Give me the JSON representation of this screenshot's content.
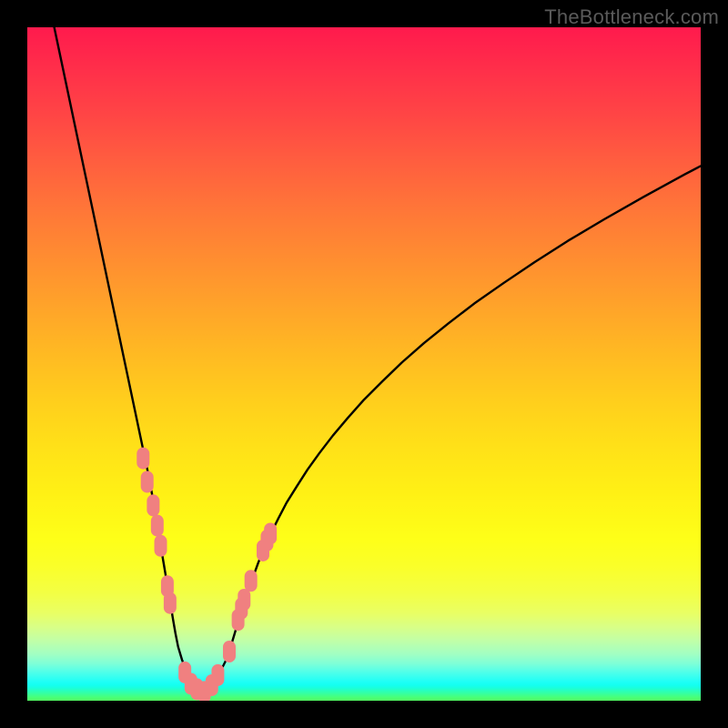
{
  "watermark": "TheBottleneck.com",
  "chart_data": {
    "type": "line",
    "title": "",
    "xlabel": "",
    "ylabel": "",
    "xlim": [
      0,
      100
    ],
    "ylim": [
      0,
      100
    ],
    "curve_left": {
      "x": [
        4,
        6,
        8,
        10,
        12,
        13,
        14,
        15,
        16,
        17,
        18,
        18.6,
        19.1,
        19.6,
        20.0,
        20.3,
        20.6,
        21.0,
        21.3,
        21.6,
        22.0,
        22.4,
        23.0,
        23.8,
        24.8,
        26.0
      ],
      "y": [
        100,
        90.5,
        81,
        71.5,
        62,
        57.25,
        52.5,
        47.75,
        43,
        38.25,
        33.5,
        30.25,
        27.3,
        24.3,
        21.85,
        20.1,
        18.3,
        16.0,
        14.2,
        12.3,
        10.0,
        8.0,
        6.0,
        4.0,
        2.2,
        1.3
      ]
    },
    "curve_right": {
      "x": [
        26,
        27.2,
        28.5,
        29.5,
        30.2,
        30.8,
        31.4,
        32.0,
        32.7,
        33.5,
        34.3,
        35.2,
        36.2,
        37.3,
        38.5,
        40.0,
        41.6,
        43.4,
        45.4,
        47.6,
        50.0,
        52.7,
        55.6,
        58.9,
        62.5,
        66.4,
        70.7,
        75.3,
        80.3,
        85.7,
        91.5,
        97.7,
        100
      ],
      "y": [
        1.3,
        2.2,
        4.0,
        6.0,
        8.0,
        10.0,
        12.0,
        14.0,
        16.1,
        18.3,
        20.5,
        22.7,
        24.9,
        27.1,
        29.4,
        31.8,
        34.3,
        36.8,
        39.4,
        42.0,
        44.7,
        47.4,
        50.2,
        53.1,
        56.0,
        59.0,
        62.0,
        65.1,
        68.3,
        71.5,
        74.8,
        78.2,
        79.4
      ]
    },
    "markers": [
      {
        "x": 17.2,
        "y": 36.0
      },
      {
        "x": 17.8,
        "y": 32.5
      },
      {
        "x": 18.7,
        "y": 29.0
      },
      {
        "x": 19.3,
        "y": 26.0
      },
      {
        "x": 19.8,
        "y": 23.0
      },
      {
        "x": 20.8,
        "y": 17.0
      },
      {
        "x": 21.2,
        "y": 14.5
      },
      {
        "x": 23.4,
        "y": 4.2
      },
      {
        "x": 24.3,
        "y": 2.5
      },
      {
        "x": 25.2,
        "y": 1.7
      },
      {
        "x": 26.3,
        "y": 1.3
      },
      {
        "x": 27.4,
        "y": 2.3
      },
      {
        "x": 28.3,
        "y": 3.8
      },
      {
        "x": 30.0,
        "y": 7.3
      },
      {
        "x": 31.3,
        "y": 12.0
      },
      {
        "x": 31.8,
        "y": 13.7
      },
      {
        "x": 32.2,
        "y": 15.0
      },
      {
        "x": 33.2,
        "y": 17.8
      },
      {
        "x": 35.0,
        "y": 22.3
      },
      {
        "x": 35.6,
        "y": 23.8
      },
      {
        "x": 36.1,
        "y": 24.8
      }
    ],
    "marker_color": "#f08080",
    "curve_color": "#000000"
  }
}
